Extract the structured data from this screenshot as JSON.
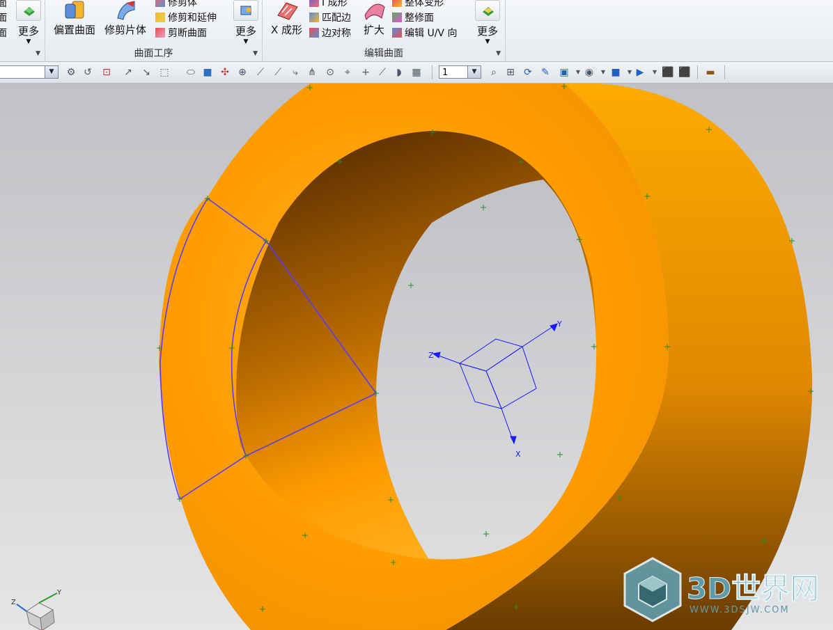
{
  "ribbon": {
    "left_group": {
      "partial_labels": [
        "面",
        "面",
        "面"
      ],
      "more_label": "更多"
    },
    "surface_ops": {
      "label": "曲面工序",
      "offset_surface": "偏置曲面",
      "trim_sheet": "修剪片体",
      "trim_body": "修剪体",
      "trim_extend": "修剪和延伸",
      "divide_face": "剪断曲面",
      "more_label": "更多"
    },
    "edit_surface": {
      "label": "编辑曲面",
      "x_form": "X 成形",
      "i_form": "I 成形",
      "match_edge": "匹配边",
      "edge_symmetry": "边对称",
      "enlarge": "扩大",
      "global_shaping": "整体变形",
      "refit_face": "整修面",
      "edit_uv": "编辑 U/V 向",
      "more_label": "更多"
    }
  },
  "toolbar": {
    "filter_value": "",
    "layer_value": "1"
  },
  "viewport": {
    "wcs_labels": {
      "x": "X",
      "y": "Y",
      "z": "Z"
    },
    "triad_labels": {
      "y": "Y",
      "z": "Z"
    },
    "watermark_text": "3D世界网",
    "watermark_url": "WWW.3DSJW.COM",
    "colors": {
      "ring": "#ff9c00",
      "selection": "#5a3cf0",
      "wcs": "#1a1aff"
    }
  }
}
